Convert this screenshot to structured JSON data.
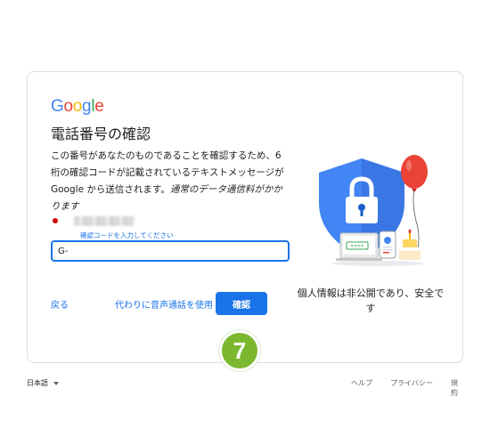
{
  "logo": {
    "letters": [
      "G",
      "o",
      "o",
      "g",
      "l",
      "e"
    ],
    "colors": [
      "#4285f4",
      "#ea4335",
      "#fbbc05",
      "#4285f4",
      "#34a853",
      "#ea4335"
    ]
  },
  "title": "電話番号の確認",
  "description": {
    "text": "この番号があなたのものであることを確認するため、6 桁の確認コードが記載されているテキストメッセージが Google から送信されます。",
    "italic": "通常のデータ通信料がかかります"
  },
  "field": {
    "label": "確認コードを入力してください",
    "value": "G-"
  },
  "buttons": {
    "back": "戻る",
    "voice": "代わりに音声通話を使用",
    "confirm": "確認"
  },
  "step_badge": "7",
  "illustration": {
    "pin_display": "****"
  },
  "privacy_text": "個人情報は非公開であり、安全です",
  "footer": {
    "language": "日本語",
    "help": "ヘルプ",
    "privacy": "プライバシー",
    "terms": "規約"
  },
  "colors": {
    "accent": "#1a73e8",
    "shield": "#4285f4",
    "balloon": "#ea4335",
    "badge": "#7cb82f"
  }
}
